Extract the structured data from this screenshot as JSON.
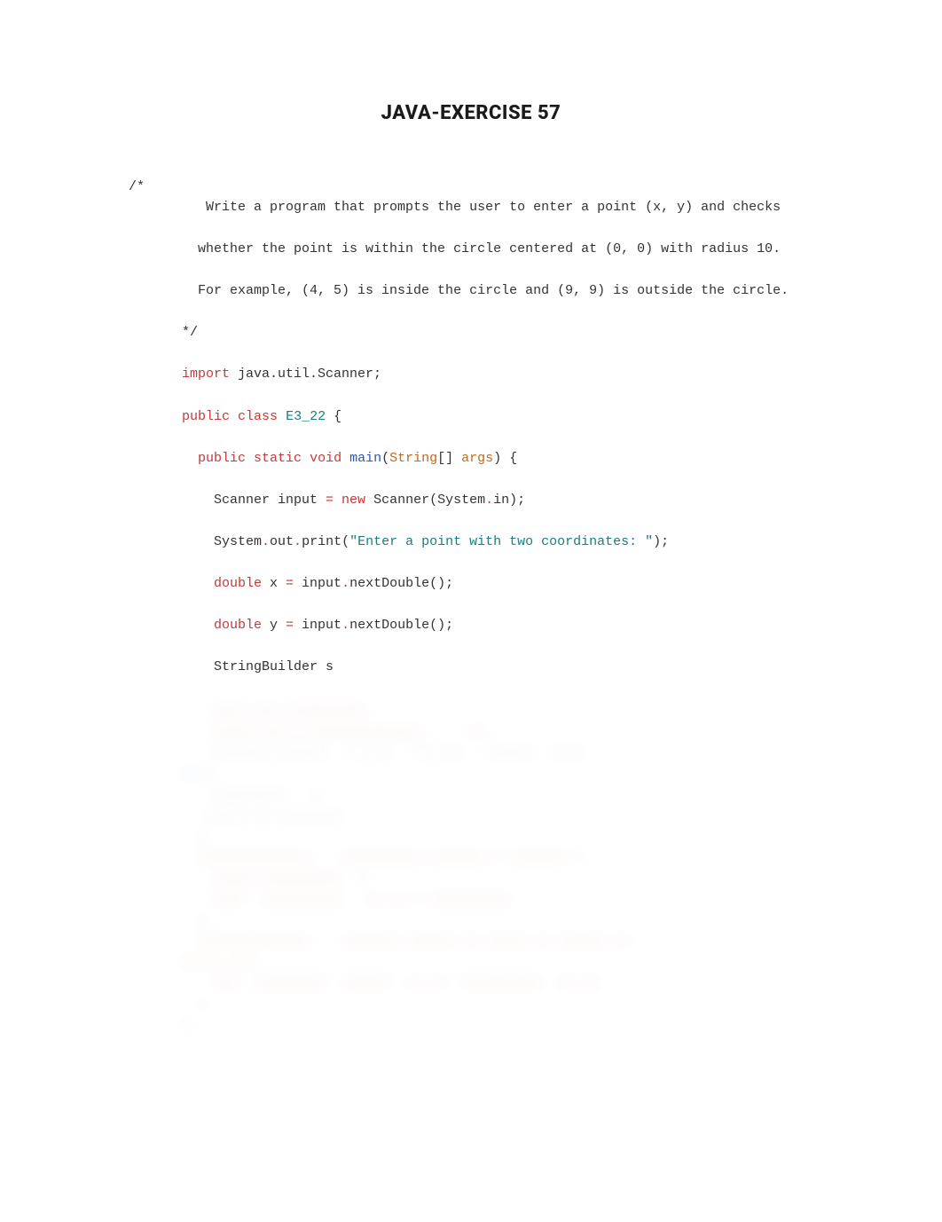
{
  "title": "JAVA-EXERCISE 57",
  "code": {
    "comment_open": "/*",
    "comment_l1": "   Write a program that prompts the user to enter a point (x, y) and checks",
    "comment_l2": "  whether the point is within the circle centered at (0, 0) with radius 10.",
    "comment_l3": "  For example, (4, 5) is inside the circle and (9, 9) is outside the circle.",
    "comment_close": "*/",
    "import_kw": "import",
    "import_rest": " java.util.Scanner;",
    "public_kw": "public",
    "class_kw": "class",
    "class_name": "E3_22",
    "brace_open": " {",
    "m_public": "public",
    "m_static": "static",
    "m_void": "void",
    "m_main": "main",
    "m_paren_open": "(",
    "m_string": "String",
    "m_brackets": "[] ",
    "m_args": "args",
    "m_paren_close": ") {",
    "l1_pre": "    Scanner input ",
    "l1_eq": "=",
    "l1_new": " new",
    "l1_scanner": " Scanner(System",
    "l1_dot": ".",
    "l1_in": "in);",
    "l2_sys": "    System",
    "l2_dot1": ".",
    "l2_out": "out",
    "l2_dot2": ".",
    "l2_print": "print(",
    "l2_str": "\"Enter a point with two coordinates: \"",
    "l2_end": ");",
    "l3_dbl": "    double",
    "l3_x": " x ",
    "l3_eq": "=",
    "l3_rest": " input",
    "l3_dot": ".",
    "l3_nd": "nextDouble();",
    "l4_dbl": "    double",
    "l4_y": " y ",
    "l4_eq": "=",
    "l4_rest": " input",
    "l4_dot": ".",
    "l4_nd": "nextDouble();",
    "l5_sb": "    StringBuilder s "
  },
  "blur": {
    "b1": "    ---- --- ----------",
    "b2": "    ----- --- - --------------      --",
    "b3": "    ------- ------   -- --   -- ---   ------  ----",
    "b4": "-- -",
    "b5": "    ---------   -",
    "b6": "   ----- -- --------",
    "b7": "  -",
    "b8": "  --------------    ---------- ------- - ------- -",
    "b9": "    ----- ----------  -",
    "b10": "    ----  ----------   -- -- - ----------",
    "b11": "  -",
    "b12": "  --------------    ------- ------ -- ----- -- ------ --",
    "b13": "----- ---",
    "b14": "    ---  ---------  ------  -- --  ----------  -- --",
    "b15": "  -",
    "b16": "-"
  }
}
